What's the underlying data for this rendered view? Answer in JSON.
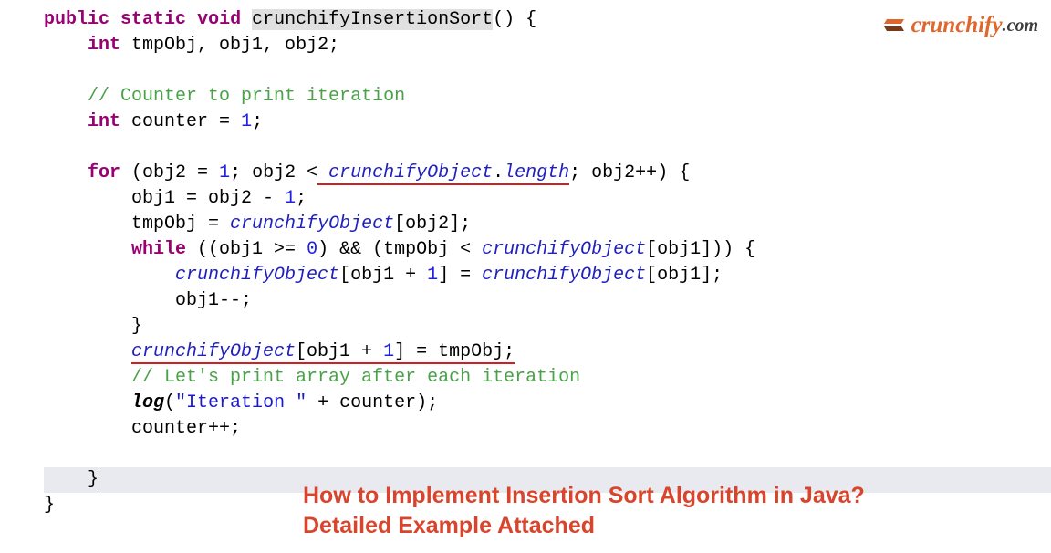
{
  "logo": {
    "main": "crunchify",
    "domain": ".com"
  },
  "title": {
    "line1": "How to Implement Insertion Sort Algorithm in Java?",
    "line2": "Detailed Example Attached"
  },
  "code": {
    "l1": {
      "kw1": "public",
      "kw2": "static",
      "kw3": "void",
      "fn": "crunchifyInsertionSort",
      "paren": "()",
      "brace": " {"
    },
    "l2": {
      "type": "int",
      "rest": " tmpObj, obj1, obj2;"
    },
    "l3": "",
    "l4": {
      "comment": "// Counter to print iteration"
    },
    "l5": {
      "type": "int",
      "mid": " counter = ",
      "num": "1",
      "end": ";"
    },
    "l6": "",
    "l7": {
      "kw": "for",
      "a": " (obj2 = ",
      "n1": "1",
      "b": "; obj2 <",
      "sp": " ",
      "f1": "crunchifyObject",
      "dot": ".",
      "len": "length",
      "c": "; obj2++) {"
    },
    "l8": {
      "a": "obj1 = obj2 - ",
      "n": "1",
      "b": ";"
    },
    "l9": {
      "a": "tmpObj = ",
      "f": "crunchifyObject",
      "b": "[obj2];"
    },
    "l10": {
      "kw": "while",
      "a": " ((obj1 >= ",
      "n": "0",
      "b": ") && (tmpObj < ",
      "f": "crunchifyObject",
      "c": "[obj1])) {"
    },
    "l11": {
      "f1": "crunchifyObject",
      "a": "[obj1 + ",
      "n1": "1",
      "b": "] = ",
      "f2": "crunchifyObject",
      "c": "[obj1];"
    },
    "l12": "obj1--;",
    "l13": "}",
    "l14": {
      "f": "crunchifyObject",
      "a": "[obj1 + ",
      "n": "1",
      "b": "] = tmpObj;"
    },
    "l15": {
      "comment": "// Let's print array after each iteration"
    },
    "l16": {
      "fn": "log",
      "a": "(",
      "s": "\"Iteration \"",
      "b": " + counter);"
    },
    "l17": "counter++;",
    "l18": "",
    "l19": "}",
    "l20": "}"
  }
}
